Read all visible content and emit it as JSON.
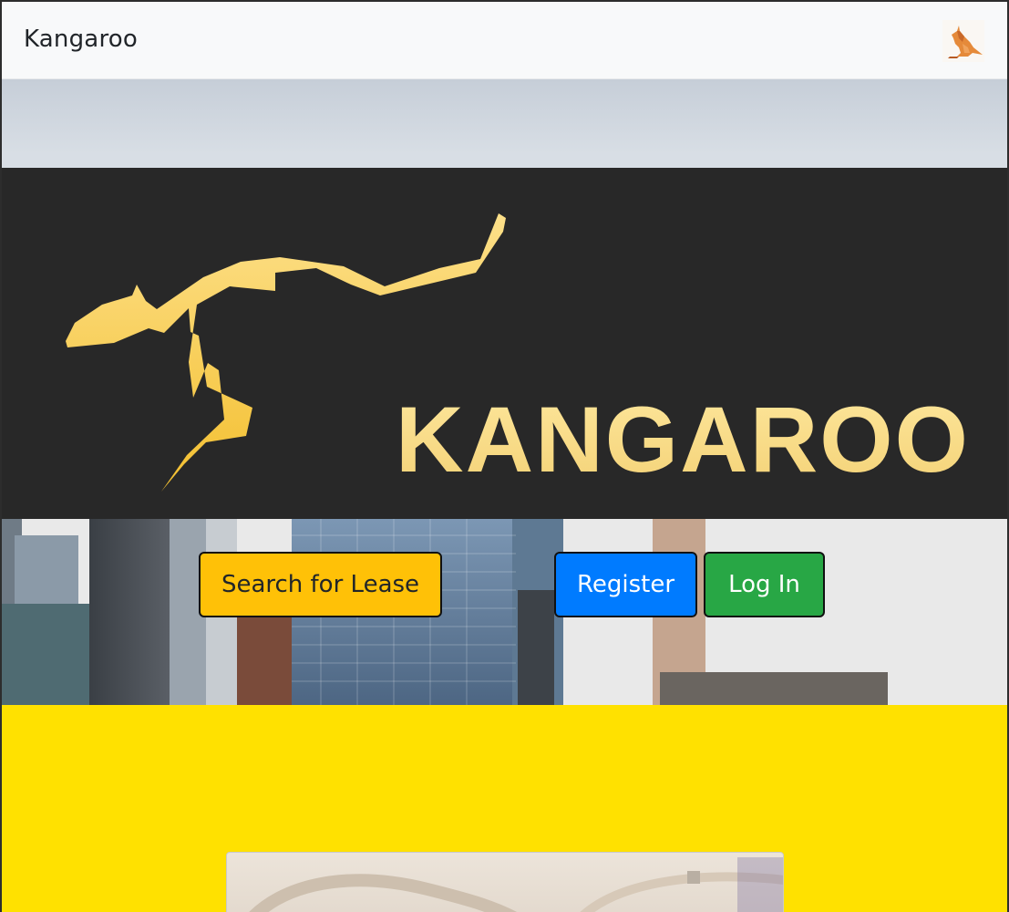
{
  "navbar": {
    "brand": "Kangaroo",
    "logo_icon": "kangaroo-icon"
  },
  "hero": {
    "banner_text": "KANGAROO",
    "logo_icon": "kangaroo-logo",
    "buttons": {
      "search_label": "Search for Lease",
      "register_label": "Register",
      "login_label": "Log In"
    }
  },
  "colors": {
    "navbar_bg": "#f8f9fa",
    "banner_bg": "#282828",
    "logo_gold": "#f5c842",
    "search_btn": "#ffc107",
    "register_btn": "#007bff",
    "login_btn": "#28a745",
    "section_yellow": "#ffe100"
  }
}
